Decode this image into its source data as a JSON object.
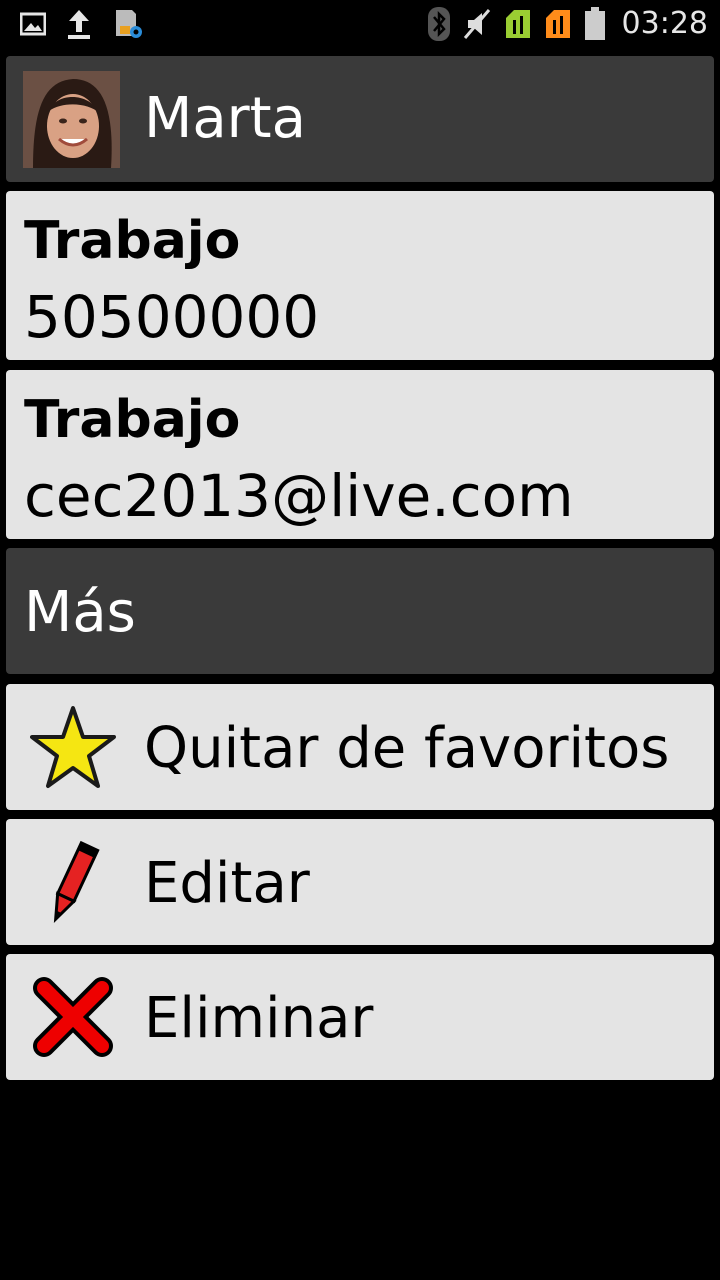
{
  "status_bar": {
    "time": "03:28",
    "icons": [
      "image-icon",
      "upload-icon",
      "sd-card-settings-icon",
      "bluetooth-icon",
      "mute-icon",
      "signal-sim1-icon",
      "signal-sim2-icon",
      "battery-icon"
    ]
  },
  "contact": {
    "name": "Marta",
    "avatar_icon": "avatar-photo"
  },
  "details": [
    {
      "label": "Trabajo",
      "value": "50500000"
    },
    {
      "label": "Trabajo",
      "value": "cec2013@live.com"
    }
  ],
  "more_section": {
    "label": "Más"
  },
  "actions": [
    {
      "label": "Quitar de favoritos",
      "icon": "star-icon"
    },
    {
      "label": "Editar",
      "icon": "pencil-icon"
    },
    {
      "label": "Eliminar",
      "icon": "delete-x-icon"
    }
  ],
  "colors": {
    "background": "#000000",
    "dark_card": "#3a3a3a",
    "light_card": "#e4e4e4",
    "star": "#f5e612",
    "delete": "#ee0000",
    "pencil": "#e52222",
    "sim1": "#9acd32",
    "sim2": "#ff8c1a"
  }
}
